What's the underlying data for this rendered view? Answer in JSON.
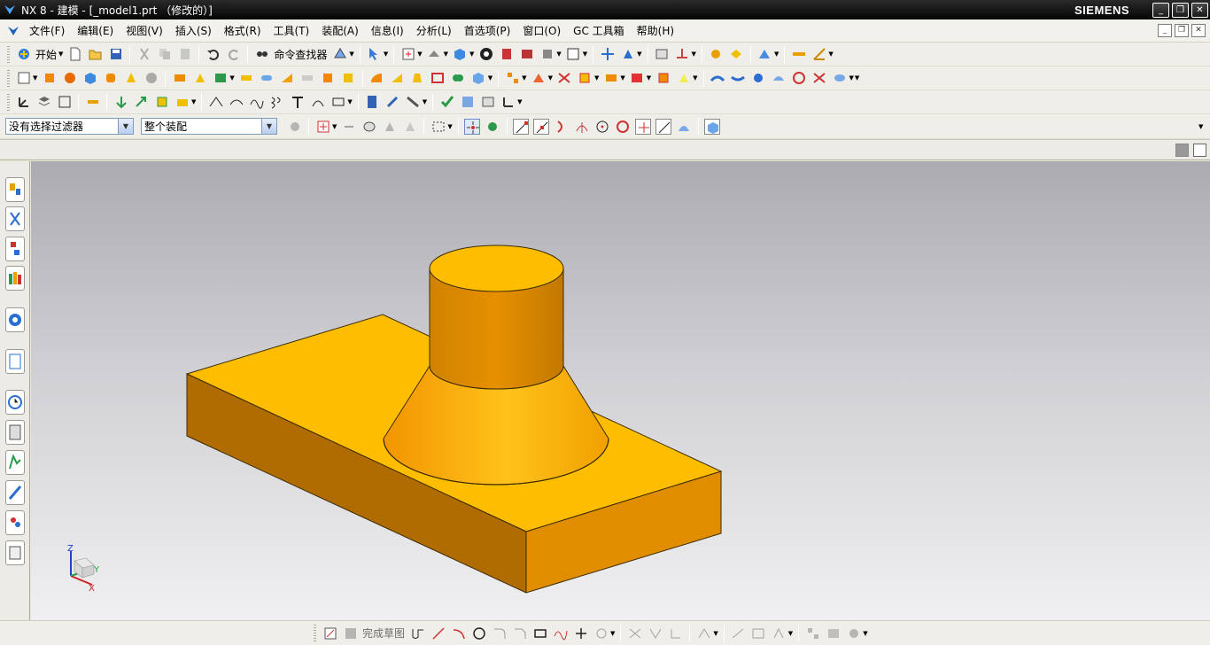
{
  "window": {
    "title": "NX 8 - 建模 - [_model1.prt （修改的）]",
    "brand": "SIEMENS",
    "controls": {
      "minimize": "_",
      "restore": "❐",
      "close": "✕"
    }
  },
  "menubar": {
    "items": [
      "文件(F)",
      "编辑(E)",
      "视图(V)",
      "插入(S)",
      "格式(R)",
      "工具(T)",
      "装配(A)",
      "信息(I)",
      "分析(L)",
      "首选项(P)",
      "窗口(O)",
      "GC 工具箱",
      "帮助(H)"
    ]
  },
  "toolbar_standard": {
    "start_label": "开始",
    "command_finder_label": "命令查找器"
  },
  "selection_bar": {
    "filter_value": "没有选择过滤器",
    "scope_value": "整个装配"
  },
  "sketch_bar": {
    "finish_sketch_label": "完成草图"
  },
  "triad": {
    "z": "Z",
    "y": "Y",
    "x": "X"
  },
  "colors": {
    "part_top": "#ffbd00",
    "part_side_dark": "#b06c00",
    "part_side_light": "#e08e00"
  },
  "icons": [
    "save-icon",
    "open-icon",
    "undo-icon",
    "redo-icon",
    "cut-icon",
    "copy-icon",
    "paste-icon",
    "shade-icon",
    "fit-icon",
    "snap-point-icon",
    "resource-navigator-icon"
  ]
}
